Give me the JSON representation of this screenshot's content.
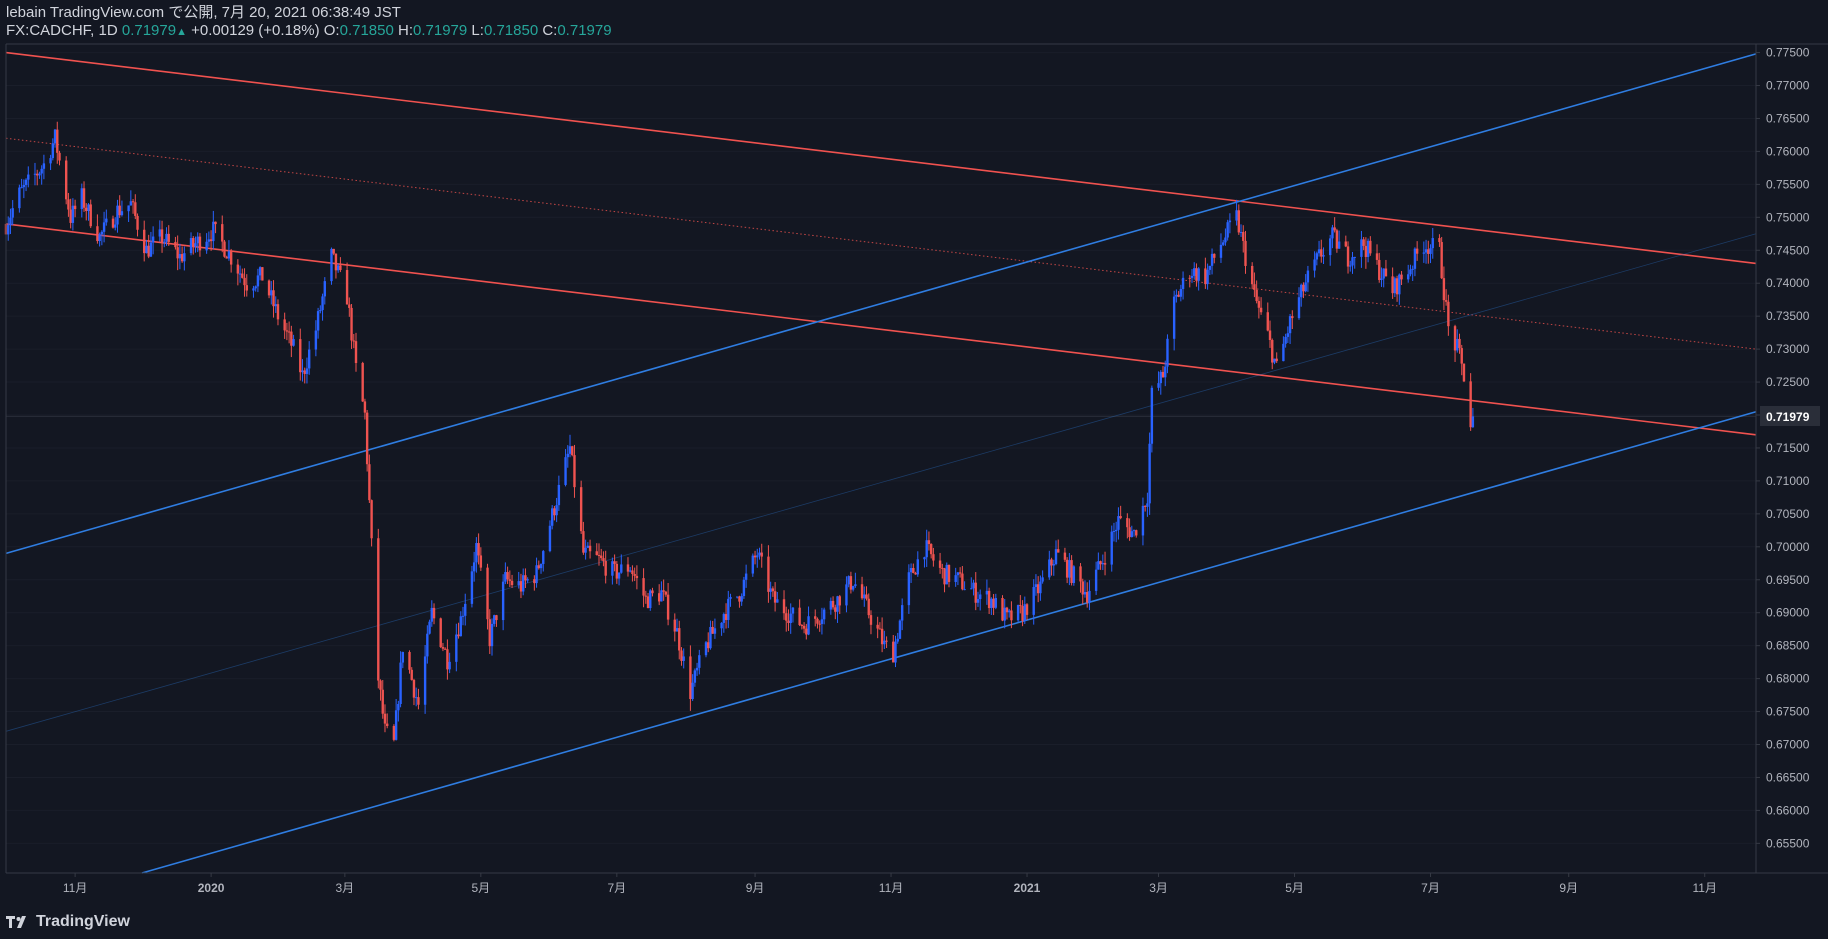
{
  "header": {
    "title": "lebain TradingView.com で公開, 7月 20, 2021 06:38:49 JST",
    "symbol": "FX:CADCHF, 1D",
    "last": "0.71979",
    "arrow": "▲",
    "change": "+0.00129 (+0.18%)",
    "o_label": "O:",
    "o_value": "0.71850",
    "h_label": "H:",
    "h_value": "0.71979",
    "l_label": "L:",
    "l_value": "0.71850",
    "c_label": "C:",
    "c_value": "0.71979"
  },
  "footer": {
    "brand": "TradingView",
    "logo_icon": "tradingview-logo-icon"
  },
  "chart_data": {
    "type": "candlestick",
    "symbol": "FX:CADCHF",
    "interval": "1D",
    "ylim": [
      0.6505,
      0.7763
    ],
    "y_ticks": [
      "0.77500",
      "0.77000",
      "0.76500",
      "0.76000",
      "0.75500",
      "0.75000",
      "0.74500",
      "0.74000",
      "0.73500",
      "0.73000",
      "0.72500",
      "0.72000",
      "0.71500",
      "0.71000",
      "0.70500",
      "0.70000",
      "0.69500",
      "0.69000",
      "0.68500",
      "0.68000",
      "0.67500",
      "0.67000",
      "0.66500",
      "0.66000",
      "0.65500"
    ],
    "y_tick_values": [
      0.775,
      0.77,
      0.765,
      0.76,
      0.755,
      0.75,
      0.745,
      0.74,
      0.735,
      0.73,
      0.725,
      0.72,
      0.715,
      0.71,
      0.705,
      0.7,
      0.695,
      0.69,
      0.685,
      0.68,
      0.675,
      0.67,
      0.665,
      0.66,
      0.655
    ],
    "x_range": [
      "2019-10-01",
      "2021-11-24"
    ],
    "x_ticks": [
      {
        "label": "11月",
        "date": "2019-11-01"
      },
      {
        "label": "2020",
        "date": "2020-01-01"
      },
      {
        "label": "3月",
        "date": "2020-03-01"
      },
      {
        "label": "5月",
        "date": "2020-05-01"
      },
      {
        "label": "7月",
        "date": "2020-07-01"
      },
      {
        "label": "9月",
        "date": "2020-09-01"
      },
      {
        "label": "11月",
        "date": "2020-11-01"
      },
      {
        "label": "2021",
        "date": "2021-01-01"
      },
      {
        "label": "3月",
        "date": "2021-03-01"
      },
      {
        "label": "5月",
        "date": "2021-05-01"
      },
      {
        "label": "7月",
        "date": "2021-07-01"
      },
      {
        "label": "9月",
        "date": "2021-09-01"
      },
      {
        "label": "11月",
        "date": "2021-11-01"
      }
    ],
    "last_price": {
      "label": "0.71979",
      "value": 0.71979
    },
    "up_color": "#2962ff",
    "down_color": "#ef5350",
    "price_path": [
      [
        "2019-10-01",
        0.749
      ],
      [
        "2019-10-07",
        0.7535
      ],
      [
        "2019-10-18",
        0.758
      ],
      [
        "2019-10-23",
        0.762
      ],
      [
        "2019-10-30",
        0.75
      ],
      [
        "2019-11-04",
        0.753
      ],
      [
        "2019-11-12",
        0.747
      ],
      [
        "2019-11-20",
        0.751
      ],
      [
        "2019-11-26",
        0.752
      ],
      [
        "2019-12-03",
        0.745
      ],
      [
        "2019-12-10",
        0.747
      ],
      [
        "2019-12-18",
        0.744
      ],
      [
        "2019-12-25",
        0.746
      ],
      [
        "2020-01-02",
        0.748
      ],
      [
        "2020-01-10",
        0.744
      ],
      [
        "2020-01-17",
        0.74
      ],
      [
        "2020-01-24",
        0.741
      ],
      [
        "2020-01-31",
        0.735
      ],
      [
        "2020-02-07",
        0.73
      ],
      [
        "2020-02-11",
        0.726
      ],
      [
        "2020-02-17",
        0.733
      ],
      [
        "2020-02-24",
        0.744
      ],
      [
        "2020-03-02",
        0.738
      ],
      [
        "2020-03-06",
        0.727
      ],
      [
        "2020-03-10",
        0.72
      ],
      [
        "2020-03-13",
        0.7
      ],
      [
        "2020-03-16",
        0.68
      ],
      [
        "2020-03-19",
        0.672
      ],
      [
        "2020-03-23",
        0.67
      ],
      [
        "2020-03-27",
        0.685
      ],
      [
        "2020-04-03",
        0.676
      ],
      [
        "2020-04-09",
        0.69
      ],
      [
        "2020-04-16",
        0.683
      ],
      [
        "2020-04-22",
        0.689
      ],
      [
        "2020-04-29",
        0.7
      ],
      [
        "2020-05-05",
        0.686
      ],
      [
        "2020-05-12",
        0.695
      ],
      [
        "2020-05-19",
        0.694
      ],
      [
        "2020-05-26",
        0.696
      ],
      [
        "2020-06-03",
        0.706
      ],
      [
        "2020-06-10",
        0.715
      ],
      [
        "2020-06-16",
        0.699
      ],
      [
        "2020-06-23",
        0.698
      ],
      [
        "2020-06-30",
        0.696
      ],
      [
        "2020-07-07",
        0.697
      ],
      [
        "2020-07-14",
        0.692
      ],
      [
        "2020-07-21",
        0.693
      ],
      [
        "2020-07-28",
        0.687
      ],
      [
        "2020-08-03",
        0.678
      ],
      [
        "2020-08-10",
        0.685
      ],
      [
        "2020-08-18",
        0.69
      ],
      [
        "2020-08-25",
        0.693
      ],
      [
        "2020-09-02",
        0.699
      ],
      [
        "2020-09-09",
        0.692
      ],
      [
        "2020-09-16",
        0.69
      ],
      [
        "2020-09-23",
        0.688
      ],
      [
        "2020-10-01",
        0.69
      ],
      [
        "2020-10-08",
        0.692
      ],
      [
        "2020-10-15",
        0.695
      ],
      [
        "2020-10-22",
        0.69
      ],
      [
        "2020-10-29",
        0.685
      ],
      [
        "2020-11-02",
        0.684
      ],
      [
        "2020-11-09",
        0.695
      ],
      [
        "2020-11-16",
        0.7
      ],
      [
        "2020-11-24",
        0.696
      ],
      [
        "2020-12-01",
        0.695
      ],
      [
        "2020-12-09",
        0.693
      ],
      [
        "2020-12-16",
        0.692
      ],
      [
        "2020-12-23",
        0.689
      ],
      [
        "2020-12-30",
        0.69
      ],
      [
        "2021-01-07",
        0.694
      ],
      [
        "2021-01-14",
        0.699
      ],
      [
        "2021-01-21",
        0.696
      ],
      [
        "2021-01-28",
        0.693
      ],
      [
        "2021-02-04",
        0.698
      ],
      [
        "2021-02-11",
        0.704
      ],
      [
        "2021-02-18",
        0.702
      ],
      [
        "2021-02-24",
        0.708
      ],
      [
        "2021-02-26",
        0.723
      ],
      [
        "2021-03-03",
        0.726
      ],
      [
        "2021-03-08",
        0.737
      ],
      [
        "2021-03-15",
        0.742
      ],
      [
        "2021-03-22",
        0.741
      ],
      [
        "2021-03-29",
        0.746
      ],
      [
        "2021-04-05",
        0.75
      ],
      [
        "2021-04-09",
        0.744
      ],
      [
        "2021-04-13",
        0.738
      ],
      [
        "2021-04-19",
        0.732
      ],
      [
        "2021-04-23",
        0.727
      ],
      [
        "2021-04-29",
        0.734
      ],
      [
        "2021-05-06",
        0.74
      ],
      [
        "2021-05-12",
        0.744
      ],
      [
        "2021-05-18",
        0.747
      ],
      [
        "2021-05-25",
        0.744
      ],
      [
        "2021-06-01",
        0.746
      ],
      [
        "2021-06-08",
        0.742
      ],
      [
        "2021-06-14",
        0.739
      ],
      [
        "2021-06-21",
        0.742
      ],
      [
        "2021-06-28",
        0.746
      ],
      [
        "2021-07-05",
        0.745
      ],
      [
        "2021-07-09",
        0.733
      ],
      [
        "2021-07-13",
        0.73
      ],
      [
        "2021-07-16",
        0.726
      ],
      [
        "2021-07-19",
        0.7185
      ],
      [
        "2021-07-20",
        0.71979
      ]
    ],
    "trendlines": [
      {
        "name": "red-channel-upper",
        "color": "#f0524f",
        "style": "solid",
        "p1": [
          "2019-10-01",
          0.775
        ],
        "p2": [
          "2021-11-24",
          0.743
        ]
      },
      {
        "name": "red-channel-middle",
        "color": "#f0524f",
        "style": "dotted",
        "p1": [
          "2019-10-01",
          0.762
        ],
        "p2": [
          "2021-11-24",
          0.73
        ]
      },
      {
        "name": "red-channel-lower",
        "color": "#f0524f",
        "style": "solid",
        "p1": [
          "2019-10-01",
          0.749
        ],
        "p2": [
          "2021-11-24",
          0.717
        ]
      },
      {
        "name": "blue-channel-upper",
        "color": "#2f7de1",
        "style": "solid",
        "p1": [
          "2019-10-01",
          0.699
        ],
        "p2": [
          "2021-11-24",
          0.7748
        ]
      },
      {
        "name": "blue-channel-middle",
        "color": "#2f7de1",
        "style": "faint",
        "p1": [
          "2019-10-01",
          0.672
        ],
        "p2": [
          "2021-11-24",
          0.7475
        ]
      },
      {
        "name": "blue-channel-lower",
        "color": "#2f7de1",
        "style": "solid",
        "p1": [
          "2019-12-01",
          0.6505
        ],
        "p2": [
          "2021-11-24",
          0.7205
        ]
      }
    ]
  }
}
